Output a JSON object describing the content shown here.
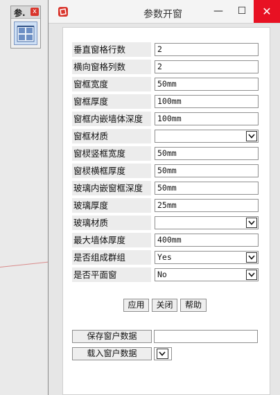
{
  "toolbar": {
    "title": "参.",
    "close_glyph": "x"
  },
  "window": {
    "title": "参数开窗",
    "minimize_glyph": "—",
    "maximize_glyph": "☐",
    "close_glyph": "✕"
  },
  "form": {
    "rows": [
      {
        "label": "垂直窗格行数",
        "type": "text",
        "value": "2"
      },
      {
        "label": "横向窗格列数",
        "type": "text",
        "value": "2"
      },
      {
        "label": "窗框宽度",
        "type": "text",
        "value": "50mm"
      },
      {
        "label": "窗框厚度",
        "type": "text",
        "value": "100mm"
      },
      {
        "label": "窗框内嵌墙体深度",
        "type": "text",
        "value": "100mm"
      },
      {
        "label": "窗框材质",
        "type": "select",
        "value": ""
      },
      {
        "label": "窗棂竖框宽度",
        "type": "text",
        "value": "50mm"
      },
      {
        "label": "窗棂横框厚度",
        "type": "text",
        "value": "50mm"
      },
      {
        "label": "玻璃内嵌窗框深度",
        "type": "text",
        "value": "50mm"
      },
      {
        "label": "玻璃厚度",
        "type": "text",
        "value": "25mm"
      },
      {
        "label": "玻璃材质",
        "type": "select",
        "value": ""
      },
      {
        "label": "最大墙体厚度",
        "type": "text",
        "value": "400mm"
      },
      {
        "label": "是否组成群组",
        "type": "select",
        "value": "Yes"
      },
      {
        "label": "是否平面窗",
        "type": "select",
        "value": "No"
      }
    ]
  },
  "actions": {
    "apply": "应用",
    "close": "关闭",
    "help": "帮助"
  },
  "data_section": {
    "save_label": "保存窗户数据",
    "load_label": "载入窗户数据",
    "save_input_value": ""
  },
  "colors": {
    "close_red": "#e81123",
    "toolbar_close_red": "#d9352c",
    "label_bg": "#ececec"
  }
}
